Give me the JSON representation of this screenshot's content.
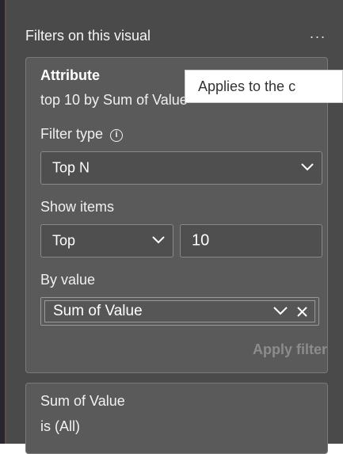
{
  "pane": {
    "title": "Filters on this visual",
    "more_label": "..."
  },
  "attribute_card": {
    "title": "Attribute",
    "summary": "top 10 by Sum of Value",
    "tooltip": "Applies to the c",
    "filter_type": {
      "label": "Filter type",
      "info_glyph": "i",
      "value": "Top N"
    },
    "show_items": {
      "label": "Show items",
      "direction": "Top",
      "count": "10"
    },
    "by_value": {
      "label": "By value",
      "field": "Sum of Value"
    },
    "apply_label": "Apply filter"
  },
  "value_card": {
    "title": "Sum of Value",
    "summary": "is (All)"
  },
  "colors": {
    "pane_bg": "#4a4a4a",
    "card_bg": "#5a5a5a",
    "input_bg": "#4f4f4f",
    "border": "#8a8a8a",
    "disabled_text": "#8c8c8c",
    "tooltip_bg": "#ffffff"
  },
  "icons": {
    "more": "more-options-icon",
    "info": "info-icon",
    "chevron": "chevron-down-icon",
    "clear": "close-icon"
  }
}
